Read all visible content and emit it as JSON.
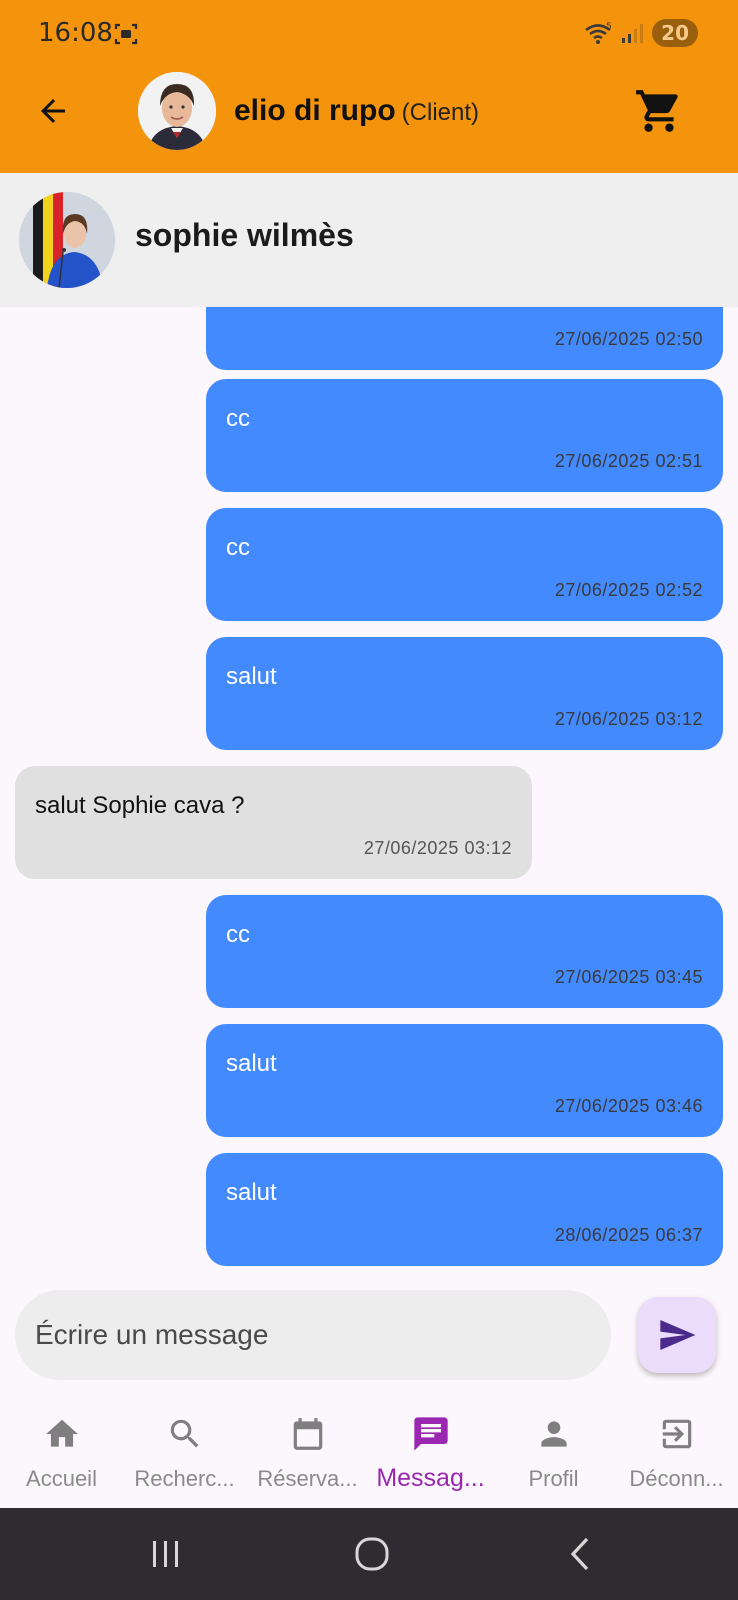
{
  "status_bar": {
    "time": "16:08",
    "battery": "20"
  },
  "header": {
    "name": "elio di rupo",
    "role": "(Client)"
  },
  "contact": {
    "name": "sophie wilmès"
  },
  "messages": [
    {
      "direction": "sent",
      "text": "",
      "time": "27/06/2025 02:50"
    },
    {
      "direction": "sent",
      "text": "cc",
      "time": "27/06/2025 02:51"
    },
    {
      "direction": "sent",
      "text": "cc",
      "time": "27/06/2025 02:52"
    },
    {
      "direction": "sent",
      "text": "salut",
      "time": "27/06/2025 03:12"
    },
    {
      "direction": "received",
      "text": "salut Sophie cava ?",
      "time": "27/06/2025 03:12"
    },
    {
      "direction": "sent",
      "text": "cc",
      "time": "27/06/2025 03:45"
    },
    {
      "direction": "sent",
      "text": "salut",
      "time": "27/06/2025 03:46"
    },
    {
      "direction": "sent",
      "text": "salut",
      "time": "28/06/2025 06:37"
    }
  ],
  "composer": {
    "placeholder": "Écrire un message",
    "value": ""
  },
  "bottom_nav": [
    {
      "label": "Accueil",
      "icon": "home-icon",
      "active": false
    },
    {
      "label": "Recherc...",
      "icon": "search-icon",
      "active": false
    },
    {
      "label": "Réserva...",
      "icon": "calendar-icon",
      "active": false
    },
    {
      "label": "Messag...",
      "icon": "message-icon",
      "active": true
    },
    {
      "label": "Profil",
      "icon": "person-icon",
      "active": false
    },
    {
      "label": "Déconn...",
      "icon": "logout-icon",
      "active": false
    }
  ],
  "colors": {
    "app_bar": "#f4930c",
    "sent_bubble": "#448aff",
    "received_bubble": "#e0e0e0",
    "active_nav": "#9a27b0"
  }
}
